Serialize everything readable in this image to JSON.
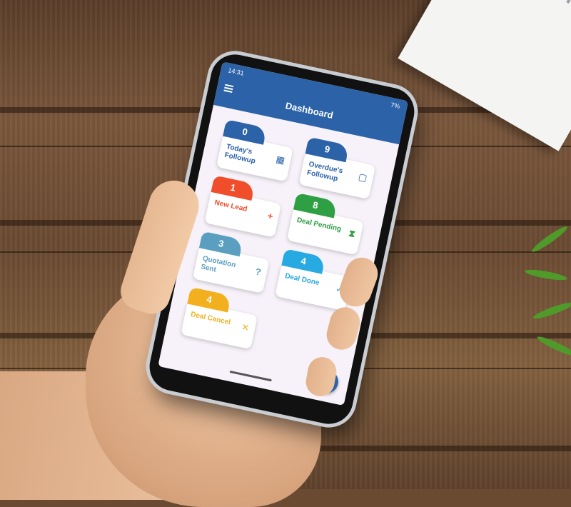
{
  "status_bar": {
    "time": "14:31",
    "battery": "7%"
  },
  "app_bar": {
    "title": "Dashboard"
  },
  "cards": [
    {
      "count": "0",
      "label": "Today's Followup",
      "color": "#2b62a8",
      "label_color": "#2b62a8",
      "icon": "calendar-icon",
      "glyph": "▦"
    },
    {
      "count": "9",
      "label": "Overdue's Followup",
      "color": "#2b62a8",
      "label_color": "#2b62a8",
      "icon": "calendar-icon",
      "glyph": "▢"
    },
    {
      "count": "1",
      "label": "New Lead",
      "color": "#f04e2a",
      "label_color": "#f04e2a",
      "icon": "plus-icon",
      "glyph": "+"
    },
    {
      "count": "8",
      "label": "Deal Pending",
      "color": "#2e9f43",
      "label_color": "#2e9f43",
      "icon": "hourglass-icon",
      "glyph": "⧗"
    },
    {
      "count": "3",
      "label": "Quotation Sent",
      "color": "#5a9fc0",
      "label_color": "#5a9fc0",
      "icon": "question-icon",
      "glyph": "?"
    },
    {
      "count": "4",
      "label": "Deal Done",
      "color": "#27a9e1",
      "label_color": "#27a9e1",
      "icon": "check-icon",
      "glyph": "✓"
    },
    {
      "count": "4",
      "label": "Deal Cancel",
      "color": "#f2b01e",
      "label_color": "#f2b01e",
      "icon": "close-icon",
      "glyph": "✕"
    }
  ],
  "fab": {
    "icon": "add-icon",
    "glyph": "+"
  }
}
